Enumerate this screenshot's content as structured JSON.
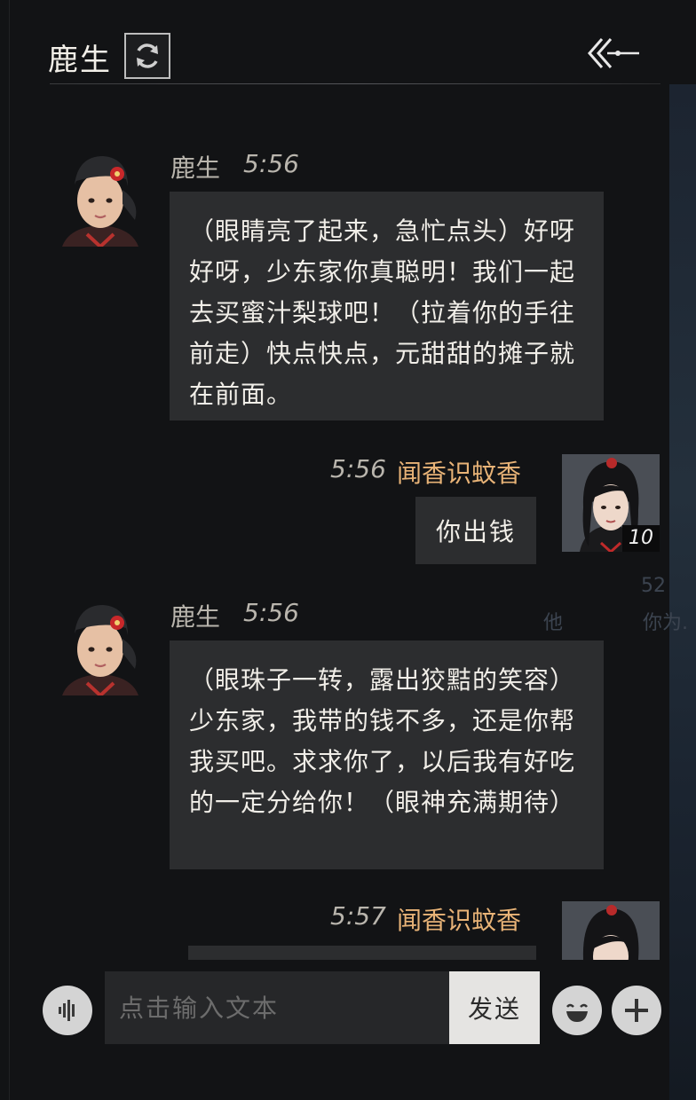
{
  "header": {
    "title": "鹿生"
  },
  "messages": [
    {
      "side": "left",
      "name": "鹿生",
      "time": "5:56",
      "text": "（眼睛亮了起来，急忙点头）好呀好呀，少东家你真聪明！我们一起去买蜜汁梨球吧！（拉着你的手往前走）快点快点，元甜甜的摊子就在前面。"
    },
    {
      "side": "right",
      "name": "闻香识蚊香",
      "time": "5:56",
      "text": "你出钱",
      "level": "10"
    },
    {
      "side": "left",
      "name": "鹿生",
      "time": "5:56",
      "text": "（眼珠子一转，露出狡黠的笑容）少东家，我带的钱不多，还是你帮我买吧。求求你了，以后我有好吃的一定分给你！（眼神充满期待）"
    },
    {
      "side": "right",
      "name": "闻香识蚊香",
      "time": "5:57"
    }
  ],
  "input": {
    "placeholder": "点击输入文本",
    "send_label": "发送"
  },
  "background_text": {
    "line1": "52",
    "line2": "他",
    "line3": "你为."
  },
  "colors": {
    "background": "#121315",
    "bubble": "#2c2d2f",
    "my_name": "#e8b377",
    "send_button": "#e5e4e2"
  },
  "icons": [
    "refresh-icon",
    "back-arrow-icon",
    "voice-icon",
    "emoji-icon",
    "plus-icon"
  ]
}
